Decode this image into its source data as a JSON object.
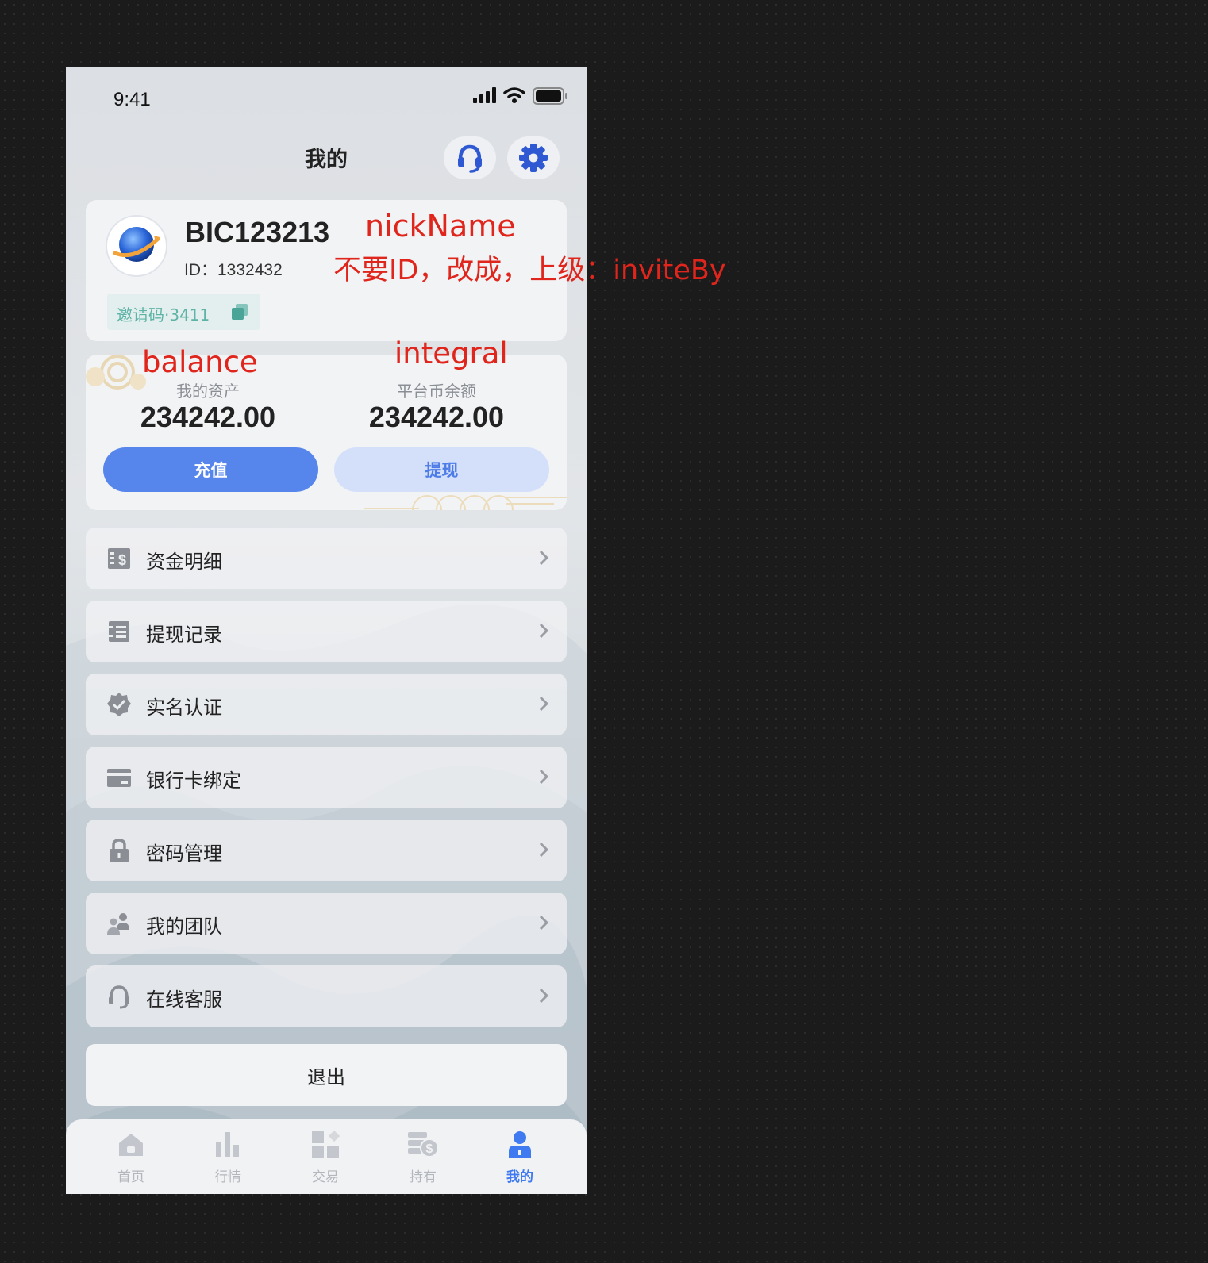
{
  "status_bar": {
    "time": "9:41"
  },
  "header": {
    "title": "我的"
  },
  "profile": {
    "nickname": "BIC123213",
    "id_text": "ID：1332432",
    "invite_code": "邀请码·3411"
  },
  "assets": {
    "balance_label": "我的资产",
    "balance_value": "234242.00",
    "platform_label": "平台币余额",
    "platform_value": "234242.00",
    "recharge_label": "充值",
    "withdraw_label": "提现"
  },
  "menu": [
    {
      "label": "资金明细",
      "icon": "dollar-list-icon"
    },
    {
      "label": "提现记录",
      "icon": "record-list-icon"
    },
    {
      "label": "实名认证",
      "icon": "verified-badge-icon"
    },
    {
      "label": "银行卡绑定",
      "icon": "bank-card-icon"
    },
    {
      "label": "密码管理",
      "icon": "lock-icon"
    },
    {
      "label": "我的团队",
      "icon": "team-icon"
    },
    {
      "label": "在线客服",
      "icon": "headset-icon"
    }
  ],
  "logout_label": "退出",
  "tabs": [
    {
      "label": "首页",
      "icon": "home-icon",
      "active": false
    },
    {
      "label": "行情",
      "icon": "bar-chart-icon",
      "active": false
    },
    {
      "label": "交易",
      "icon": "grid-icon",
      "active": false
    },
    {
      "label": "持有",
      "icon": "holdings-icon",
      "active": false
    },
    {
      "label": "我的",
      "icon": "user-icon",
      "active": true
    }
  ],
  "annotations": {
    "nickname_note": "nickName",
    "id_note": "不要ID，改成，上级：inviteBy",
    "balance_note": "balance",
    "integral_note": "integral"
  },
  "colors": {
    "accent": "#5686ec",
    "accent_light": "#d4e0fa",
    "annotation": "#e0251c",
    "invite_text": "#5eb3a6"
  }
}
